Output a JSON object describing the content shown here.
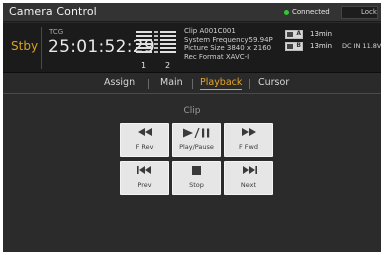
{
  "window": {
    "title": "Camera Control",
    "connection": "Connected",
    "lock": "Lock"
  },
  "status": {
    "mode": "Stby",
    "tc_label": "TCG",
    "timecode": "25:01:52:29",
    "audio_channels": [
      "1",
      "2"
    ],
    "clip": "Clip A001C001",
    "system_frequency": "System Frequency59.94P",
    "picture_size": "Picture Size 3840 x 2160",
    "rec_format": "Rec Format  XAVC-I",
    "media": [
      {
        "slot": "A",
        "time": "13min"
      },
      {
        "slot": "B",
        "time": "13min"
      }
    ],
    "power": "DC IN 11.8V"
  },
  "tabs": [
    {
      "label": "Assign",
      "active": false
    },
    {
      "label": "Main",
      "active": false
    },
    {
      "label": "Playback",
      "active": true
    },
    {
      "label": "Cursor",
      "active": false
    }
  ],
  "clip_section": {
    "label": "Clip",
    "buttons": [
      {
        "label": "F Rev",
        "icon": "fast-rewind-icon"
      },
      {
        "label": "Play/Pause",
        "icon": "play-pause-icon"
      },
      {
        "label": "F Fwd",
        "icon": "fast-forward-icon"
      },
      {
        "label": "Prev",
        "icon": "previous-icon"
      },
      {
        "label": "Stop",
        "icon": "stop-icon"
      },
      {
        "label": "Next",
        "icon": "next-icon"
      }
    ]
  },
  "colors": {
    "accent": "#e7a625",
    "standby": "#d8a21e",
    "connected": "#32c832"
  }
}
